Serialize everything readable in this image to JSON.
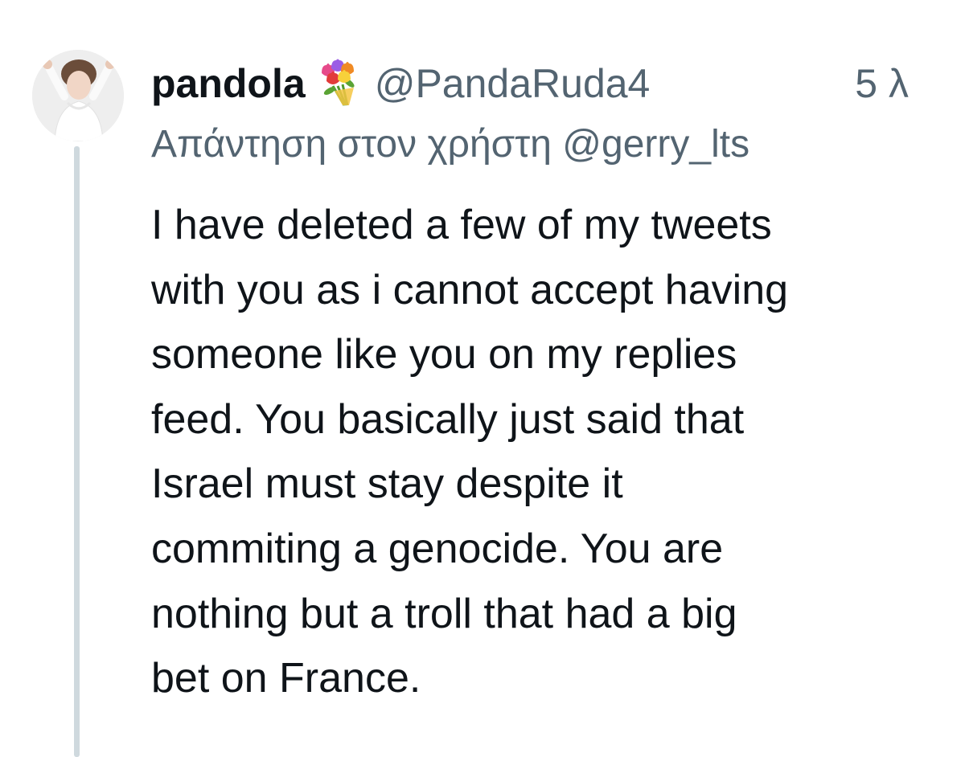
{
  "tweet": {
    "display_name": "pandola",
    "name_emoji": "bouquet-emoji",
    "handle": "@PandaRuda4",
    "timestamp": "5 λ",
    "reply_prefix": "Απάντηση στον χρήστη",
    "reply_mention": "@gerry_lts",
    "text_lines": [
      "I have deleted a few of my tweets",
      "with you as i cannot accept having",
      "someone like you on my replies",
      "feed. You basically just said that",
      "Israel must stay despite it",
      "commiting a genocide. You are",
      "nothing but a troll that had a big",
      "bet on France."
    ]
  },
  "colors": {
    "text_primary": "#0f1419",
    "text_secondary": "#536471",
    "thread_line": "#cfd9de",
    "background": "#ffffff"
  }
}
